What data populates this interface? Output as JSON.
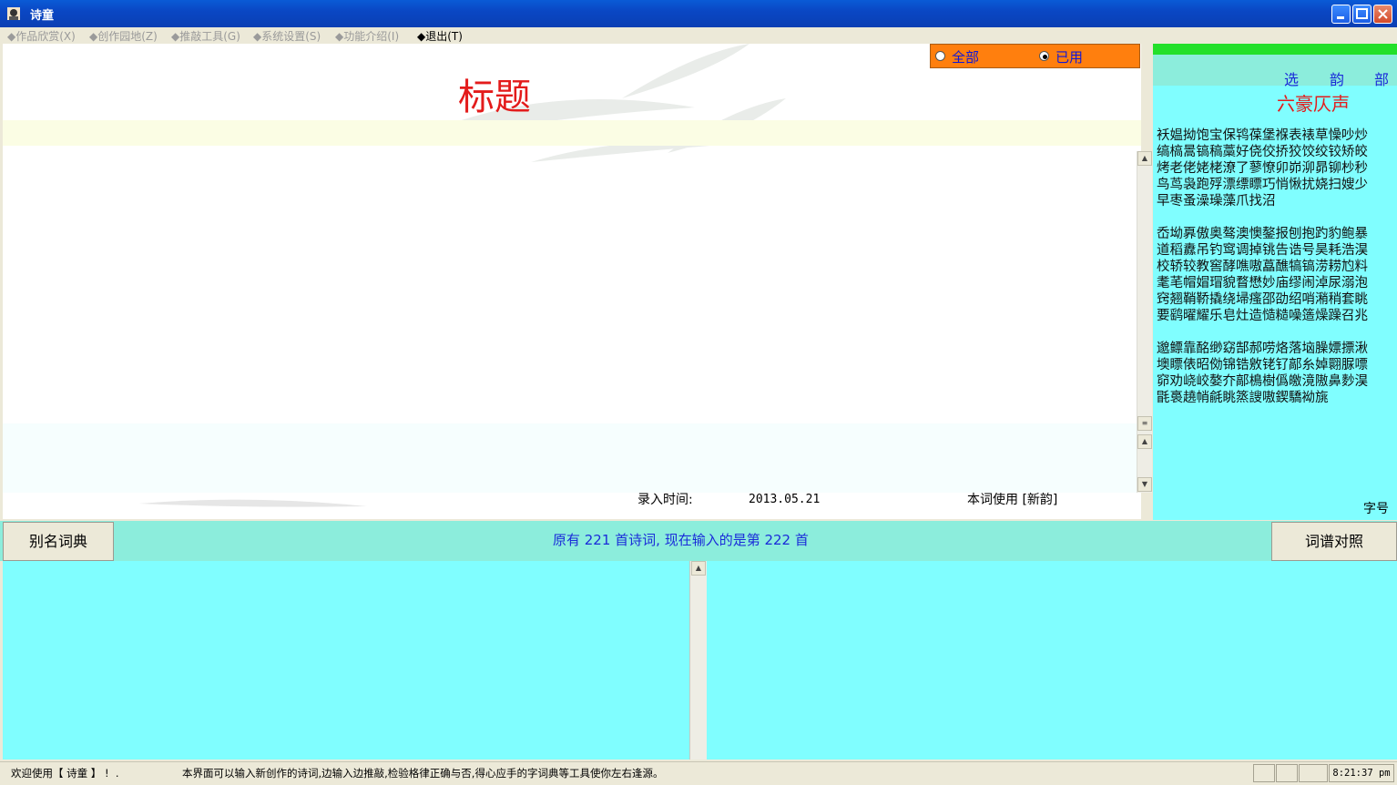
{
  "window": {
    "title": "诗童"
  },
  "menu": [
    {
      "label": "◆作品欣赏(X)",
      "enabled": false
    },
    {
      "label": "◆创作园地(Z)",
      "enabled": false
    },
    {
      "label": "◆推敲工具(G)",
      "enabled": false
    },
    {
      "label": "◆系统设置(S)",
      "enabled": false
    },
    {
      "label": "◆功能介绍(I)",
      "enabled": false
    },
    {
      "label": "◆退出(T)",
      "enabled": true
    }
  ],
  "editor": {
    "title_placeholder": "标题",
    "input_time_label": "录入时间:",
    "input_time_value": "2013.05.21",
    "rhyme_usage": "本词使用 [新韵]"
  },
  "filter": {
    "options": [
      "全部",
      "已用"
    ],
    "selected": "已用"
  },
  "rhyme_panel": {
    "tabs": [
      "选",
      "韵",
      "部"
    ],
    "title": "六豪仄声",
    "blocks": [
      "袄媪拗饱宝保鸨葆堡褓表裱草懆吵炒",
      "缟槁暠镐稿藁好侥佼挢狡饺绞铰矫皎",
      "烤老佬姥栳潦了蓼憭卯峁泖昴铆杪秒",
      "鸟茑袅跑殍漂缥瞟巧悄愀扰娆扫嫂少",
      "早枣蚤澡璪藻爪找沼",
      "",
      "岙坳奡傲奥骜澳懊鏊报刨抱趵豹鲍暴",
      "道稻纛吊钓窎调掉铫告诰号昊耗浩淏",
      "校轿较教窖酵噍嗷藠醮犒镐涝耢尥料",
      "耄芼帽媢瑁貌瞀懋妙庙缪闹淖尿溺泡",
      "窍翘鞘鞒撬绕埽瘙邵劭绍哨潲稍套眺",
      "要鹞曜耀乐皂灶造慥糙噪簉燥躁召兆",
      "",
      "邈鳔靠酩缈窈郜郝唠烙落垴臊嫖摽湫",
      "墺瞟俵昭俲锦锆敫铑钌鄗糸婥翾脲嘌",
      "窌劝峣峧嫯夰鄗樢樹僞皦滰隞鼻麨淏",
      "毷裛趬帩毹眺篜謏嗷鍥驕袎旐"
    ],
    "font_size_label": "字号"
  },
  "info": {
    "alias_dict": "别名词典",
    "ci_pu": "词谱对照",
    "count_text": "原有 221 首诗词, 现在输入的是第 222 首"
  },
  "status": {
    "welcome": "欢迎使用【 诗童 】 !  .",
    "hint": "本界面可以输入新创作的诗词,边输入边推敲,检验格律正确与否,得心应手的字词典等工具使你左右逢源。",
    "clock": "8:21:37 pm"
  },
  "colors": {
    "title_red": "#e31b1b",
    "cyan_panel": "#80feff",
    "teal_strip": "#8ceddc",
    "filter_orange": "#ff7f0e",
    "green_bar": "#23e02a"
  }
}
